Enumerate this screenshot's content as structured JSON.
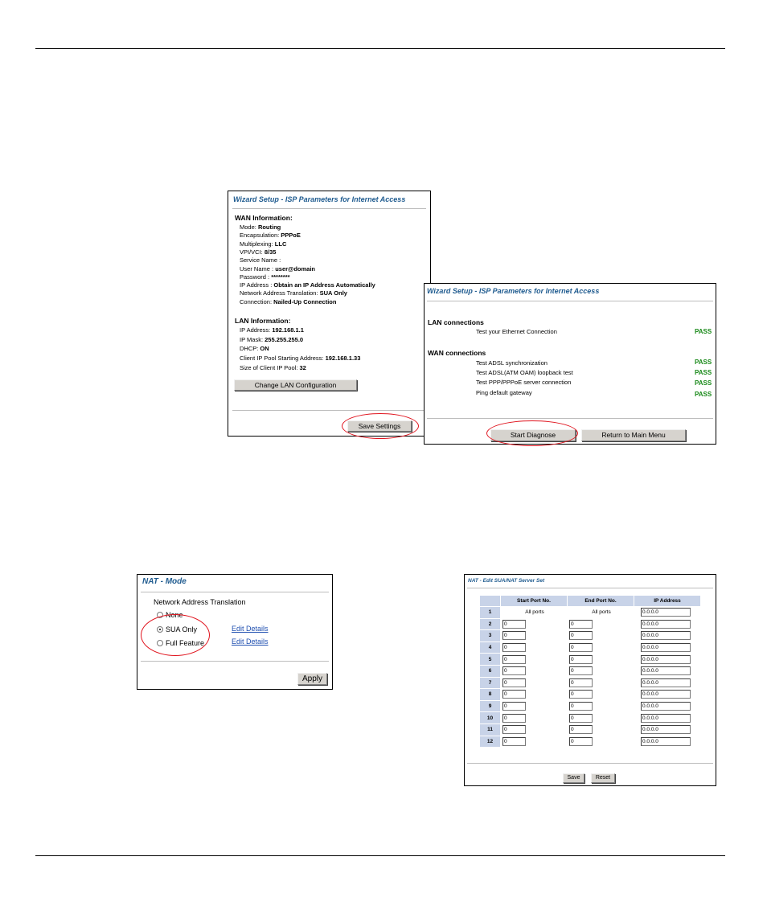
{
  "wizard1": {
    "title": "Wizard Setup - ISP Parameters for Internet Access",
    "wan_heading": "WAN Information:",
    "wan": [
      {
        "label": "Mode: ",
        "value": "Routing"
      },
      {
        "label": "Encapsulation: ",
        "value": "PPPoE"
      },
      {
        "label": "Multiplexing: ",
        "value": "LLC"
      },
      {
        "label": "VPI/VCI: ",
        "value": "8/35"
      },
      {
        "label": "Service Name : ",
        "value": ""
      },
      {
        "label": "User Name : ",
        "value": "user@domain"
      },
      {
        "label": "Password : ",
        "value": "********"
      },
      {
        "label": "IP Address : ",
        "value": "Obtain an IP Address Automatically"
      },
      {
        "label": "Network Address Translation: ",
        "value": "SUA Only"
      },
      {
        "label": "Connection: ",
        "value": "Nailed-Up Connection"
      }
    ],
    "lan_heading": "LAN Information:",
    "lan": [
      {
        "label": "IP Address: ",
        "value": "192.168.1.1"
      },
      {
        "label": "IP Mask: ",
        "value": "255.255.255.0"
      },
      {
        "label": "DHCP: ",
        "value": "ON"
      },
      {
        "label": "Client IP Pool Starting Address: ",
        "value": "192.168.1.33"
      },
      {
        "label": "Size of Client IP Pool: ",
        "value": "32"
      }
    ],
    "change_lan_button": "Change LAN Configuration",
    "save_button": "Save Settings"
  },
  "wizard2": {
    "title": "Wizard Setup - ISP Parameters for Internet Access",
    "lan_heading": "LAN connections",
    "lan_tests": [
      {
        "name": "Test your Ethernet Connection",
        "result": "PASS"
      }
    ],
    "wan_heading": "WAN connections",
    "wan_tests": [
      {
        "name": "Test ADSL synchronization",
        "result": "PASS"
      },
      {
        "name": "Test ADSL(ATM OAM) loopback test",
        "result": "PASS"
      },
      {
        "name": "Test PPP/PPPoE server connection",
        "result": "PASS"
      },
      {
        "name": "Ping default gateway",
        "result": "PASS"
      }
    ],
    "start_button": "Start Diagnose",
    "return_button": "Return to Main Menu"
  },
  "nat_mode": {
    "title": "NAT - Mode",
    "label": "Network Address Translation",
    "options": [
      {
        "label": "None",
        "selected": false
      },
      {
        "label": "SUA Only",
        "selected": true
      },
      {
        "label": "Full Feature",
        "selected": false
      }
    ],
    "edit_details": "Edit Details",
    "apply_button": "Apply"
  },
  "nat_server": {
    "title": "NAT - Edit SUA/NAT Server Set",
    "headers": [
      "",
      "Start Port No.",
      "End Port No.",
      "IP Address"
    ],
    "rows": [
      {
        "num": "1",
        "start": "All ports",
        "end": "All ports",
        "ip": "0.0.0.0"
      },
      {
        "num": "2",
        "start": "0",
        "end": "0",
        "ip": "0.0.0.0"
      },
      {
        "num": "3",
        "start": "0",
        "end": "0",
        "ip": "0.0.0.0"
      },
      {
        "num": "4",
        "start": "0",
        "end": "0",
        "ip": "0.0.0.0"
      },
      {
        "num": "5",
        "start": "0",
        "end": "0",
        "ip": "0.0.0.0"
      },
      {
        "num": "6",
        "start": "0",
        "end": "0",
        "ip": "0.0.0.0"
      },
      {
        "num": "7",
        "start": "0",
        "end": "0",
        "ip": "0.0.0.0"
      },
      {
        "num": "8",
        "start": "0",
        "end": "0",
        "ip": "0.0.0.0"
      },
      {
        "num": "9",
        "start": "0",
        "end": "0",
        "ip": "0.0.0.0"
      },
      {
        "num": "10",
        "start": "0",
        "end": "0",
        "ip": "0.0.0.0"
      },
      {
        "num": "11",
        "start": "0",
        "end": "0",
        "ip": "0.0.0.0"
      },
      {
        "num": "12",
        "start": "0",
        "end": "0",
        "ip": "0.0.0.0"
      }
    ],
    "save_button": "Save",
    "reset_button": "Reset"
  },
  "colors": {
    "title_blue": "#1f5b8f",
    "pass_green": "#1a8a1a",
    "highlight_red": "#e0141e",
    "table_header": "#c8d3e8"
  }
}
